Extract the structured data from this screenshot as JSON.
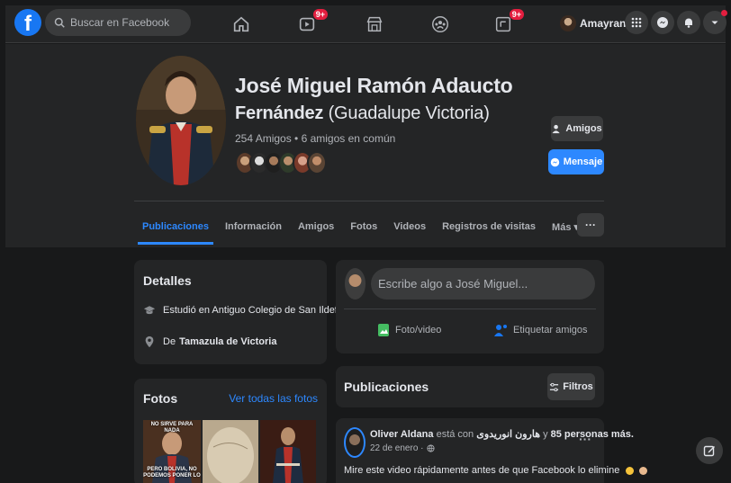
{
  "topbar": {
    "logo": "f",
    "search_placeholder": "Buscar en Facebook",
    "nav": [
      {
        "icon": "home-icon"
      },
      {
        "icon": "video-icon",
        "badge": "9+"
      },
      {
        "icon": "marketplace-icon"
      },
      {
        "icon": "groups-icon"
      },
      {
        "icon": "gaming-icon",
        "badge": "9+"
      }
    ],
    "user_name": "Amayrani"
  },
  "profile": {
    "name_line1": "José Miguel Ramón Adaucto",
    "name_line2_bold": "Fernández",
    "name_line2_alt": "(Guadalupe Victoria)",
    "friends": "254 Amigos • 6 amigos en común",
    "btn_friends": "Amigos",
    "btn_message": "Mensaje"
  },
  "tabs": [
    "Publicaciones",
    "Información",
    "Amigos",
    "Fotos",
    "Videos",
    "Registros de visitas",
    "Más ▾"
  ],
  "tabs_more": "···",
  "details": {
    "title": "Detalles",
    "education": "Estudió en Antiguo Colegio de San Ildefonso",
    "from_prefix": "De",
    "from_place": "Tamazula de Victoria"
  },
  "photos": {
    "title": "Fotos",
    "see_all": "Ver todas las fotos",
    "captions": [
      "NO SIRVE PARA NADA",
      "PERO BOLIVIA, NO PODEMOS PONER LO"
    ]
  },
  "composer": {
    "placeholder": "Escribe algo a José Miguel...",
    "photo_video": "Foto/video",
    "tag_friends": "Etiquetar amigos"
  },
  "posts_header": {
    "title": "Publicaciones",
    "filters": "Filtros"
  },
  "post": {
    "author": "Oliver Aldana",
    "with_text": "está con",
    "tagged": "هارون انوریدوی",
    "and_text": "y",
    "others": "85 personas más.",
    "date": "22 de enero ·",
    "text": "Mire este video rápidamente antes de que Facebook lo elimine",
    "dots": "···"
  },
  "colors": {
    "accent": "#2d88ff",
    "surface": "#242526",
    "background": "#18191a",
    "badge": "#e41e3f"
  }
}
